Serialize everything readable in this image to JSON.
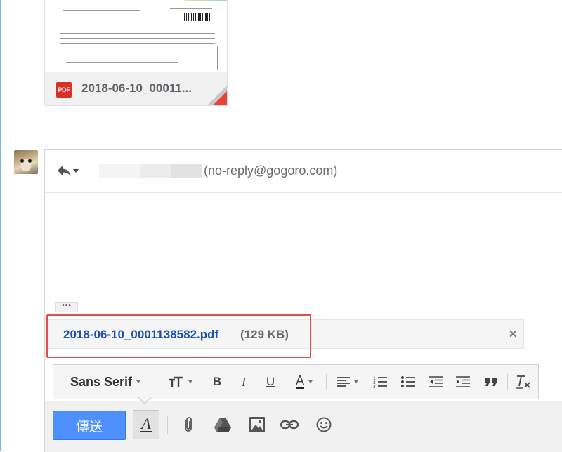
{
  "previous_attachment": {
    "icon": "pdf-icon",
    "icon_text": "PDF",
    "file_name": "2018-06-10_00011..."
  },
  "reply": {
    "action_icon": "reply-icon",
    "recipient_email": "(no-reply@gogoro.com)"
  },
  "quote_toggle": "•••",
  "attachment": {
    "file_name": "2018-06-10_0001138582.pdf",
    "size": "(129 KB)",
    "remove_label": "✕"
  },
  "toolbar": {
    "font_family": "Sans Serif",
    "bold": "B",
    "italic": "I",
    "underline": "U",
    "text_color": "A"
  },
  "bottom": {
    "send_label": "傳送",
    "format_label": "A"
  },
  "colors": {
    "send_button": "#4d90fe",
    "attachment_link": "#1a4fb5",
    "highlight": "#e14c4c",
    "pdf_icon": "#d93025"
  }
}
